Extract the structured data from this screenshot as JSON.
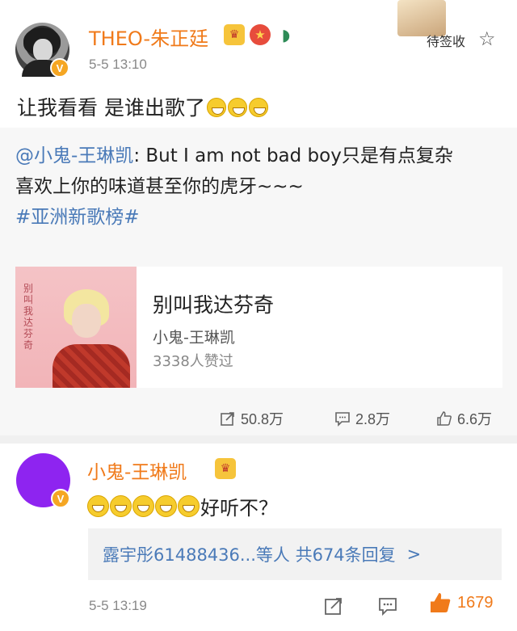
{
  "post": {
    "author": "THEO-朱正廷",
    "time": "5-5 13:10",
    "text": "让我看看 是谁出歌了",
    "verified_badge": "V",
    "card_label": "待签收",
    "badge_icons": [
      "crown-badge-icon",
      "star-badge-icon",
      "watermelon-icon"
    ]
  },
  "repost": {
    "mention": "@小鬼-王琳凯",
    "text_after_mention": ": But I am not bad boy只是有点复杂",
    "line2": "喜欢上你的味道甚至你的虎牙~~~",
    "topic": "#亚洲新歌榜#",
    "music": {
      "title": "别叫我达芬奇",
      "artist": "小鬼-王琳凯",
      "likes": "3338人赞过",
      "cover_text": "别叫我达芬奇"
    }
  },
  "actions": {
    "share": "50.8万",
    "comments": "2.8万",
    "likes": "6.6万"
  },
  "comment": {
    "author": "小鬼-王琳凯",
    "verified_badge": "V",
    "text": "好听不？",
    "replies": "露宇彤61488436...等人  共674条回复",
    "replies_chevron": ">",
    "time": "5-5 13:19",
    "likes": "1679"
  },
  "colors": {
    "username": "#f07a1a",
    "link": "#4a7ab8",
    "repost_bg": "#f7f7f7",
    "comment_avatar": "#8e24f0"
  }
}
